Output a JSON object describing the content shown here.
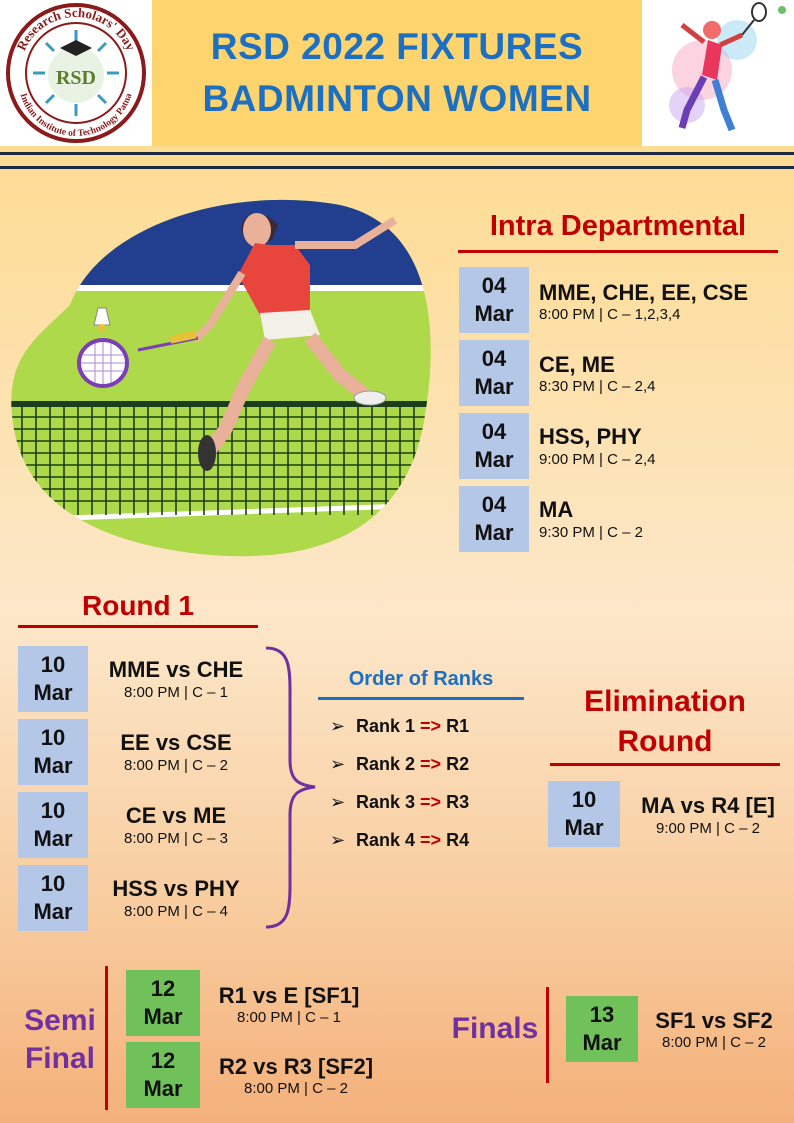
{
  "header": {
    "title_line1": "RSD 2022 FIXTURES",
    "title_line2": "BADMINTON WOMEN",
    "logo": {
      "outer_text": "Research Scholars' Day",
      "inner_text": "RSD",
      "bottom_text": "Indian Institute of Technology Patna"
    }
  },
  "intra": {
    "heading": "Intra Departmental",
    "matches": [
      {
        "day": "04",
        "month": "Mar",
        "teams": "MME, CHE, EE, CSE",
        "detail": "8:00 PM  |  C – 1,2,3,4"
      },
      {
        "day": "04",
        "month": "Mar",
        "teams": "CE, ME",
        "detail": "8:30 PM  |  C – 2,4"
      },
      {
        "day": "04",
        "month": "Mar",
        "teams": "HSS, PHY",
        "detail": "9:00 PM  |  C – 2,4"
      },
      {
        "day": "04",
        "month": "Mar",
        "teams": "MA",
        "detail": "9:30 PM  |  C – 2"
      }
    ]
  },
  "round1": {
    "heading": "Round 1",
    "matches": [
      {
        "day": "10",
        "month": "Mar",
        "teams": "MME vs CHE",
        "detail": "8:00 PM  |  C – 1"
      },
      {
        "day": "10",
        "month": "Mar",
        "teams": "EE vs CSE",
        "detail": "8:00 PM  |  C – 2"
      },
      {
        "day": "10",
        "month": "Mar",
        "teams": "CE vs ME",
        "detail": "8:00 PM  |  C – 3"
      },
      {
        "day": "10",
        "month": "Mar",
        "teams": "HSS vs PHY",
        "detail": "8:00 PM  |  C – 4"
      }
    ]
  },
  "ranks": {
    "heading": "Order of Ranks",
    "items": [
      {
        "rank": "Rank 1",
        "arrow": "=>",
        "code": "R1"
      },
      {
        "rank": "Rank 2",
        "arrow": "=>",
        "code": "R2"
      },
      {
        "rank": "Rank 3",
        "arrow": "=>",
        "code": "R3"
      },
      {
        "rank": "Rank 4",
        "arrow": "=>",
        "code": "R4"
      }
    ]
  },
  "elimination": {
    "heading_line1": "Elimination",
    "heading_line2": "Round",
    "match": {
      "day": "10",
      "month": "Mar",
      "teams": "MA vs R4 [E]",
      "detail": "9:00 PM  |  C – 2"
    }
  },
  "semifinal": {
    "heading_line1": "Semi",
    "heading_line2": "Final",
    "matches": [
      {
        "day": "12",
        "month": "Mar",
        "teams": "R1 vs E [SF1]",
        "detail": "8:00 PM  |  C – 1"
      },
      {
        "day": "12",
        "month": "Mar",
        "teams": "R2 vs R3 [SF2]",
        "detail": "8:00 PM  |  C – 2"
      }
    ]
  },
  "finals": {
    "heading": "Finals",
    "match": {
      "day": "13",
      "month": "Mar",
      "teams": "SF1 vs SF2",
      "detail": "8:00 PM  |  C – 2"
    }
  },
  "colors": {
    "title_blue": "#1d6fbf",
    "heading_red": "#c00000",
    "purple": "#7030a0",
    "date_blue": "#b4c7e7",
    "date_green": "#70c15a"
  }
}
